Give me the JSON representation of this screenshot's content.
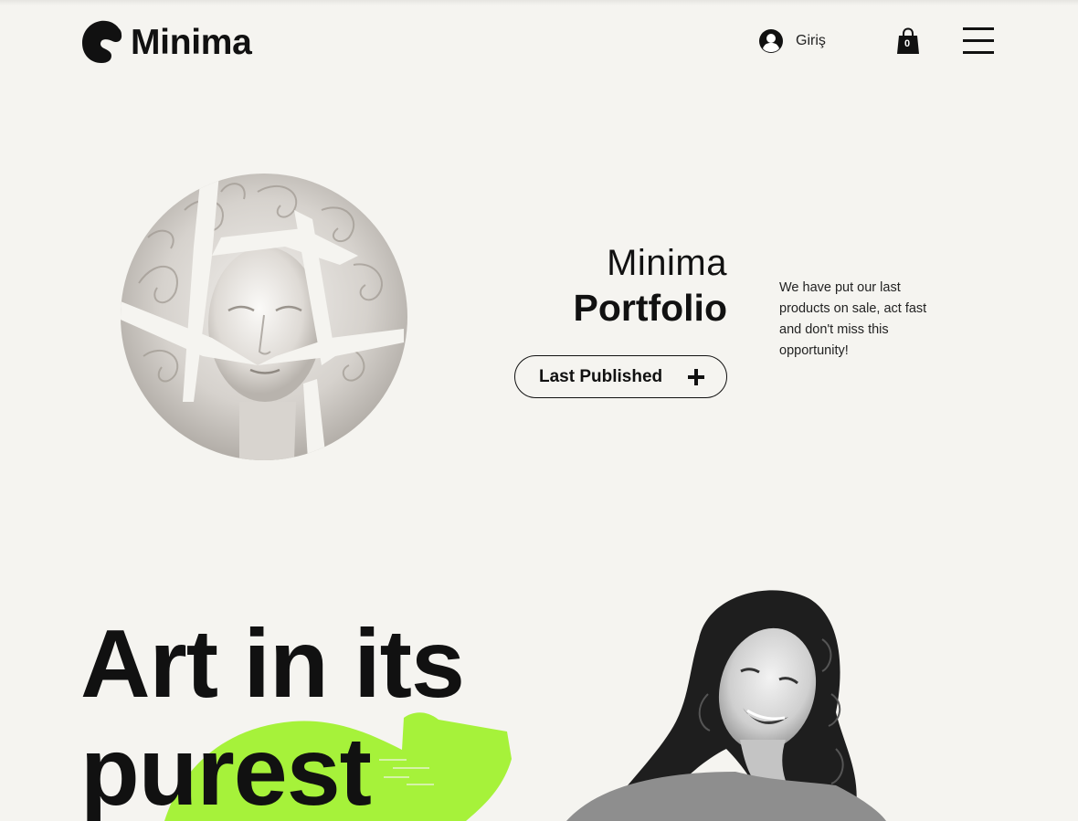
{
  "header": {
    "brand": "Minima",
    "login_label": "Giriş",
    "cart_count": "0"
  },
  "hero": {
    "title_line1": "Minima",
    "title_line2": "Portfolio",
    "button_label": "Last Published",
    "description": "We have put our last products on sale, act fast and don't miss this opportunity!"
  },
  "feature": {
    "headline_line1": "Art in its",
    "headline_line2": "purest"
  },
  "colors": {
    "background": "#f5f4f0",
    "accent": "#a6f23a",
    "text": "#111111"
  },
  "icons": {
    "logo": "c-logo-mark",
    "login": "user-avatar-icon",
    "cart": "shopping-bag-icon",
    "menu": "hamburger-menu-icon",
    "button": "plus-icon"
  }
}
